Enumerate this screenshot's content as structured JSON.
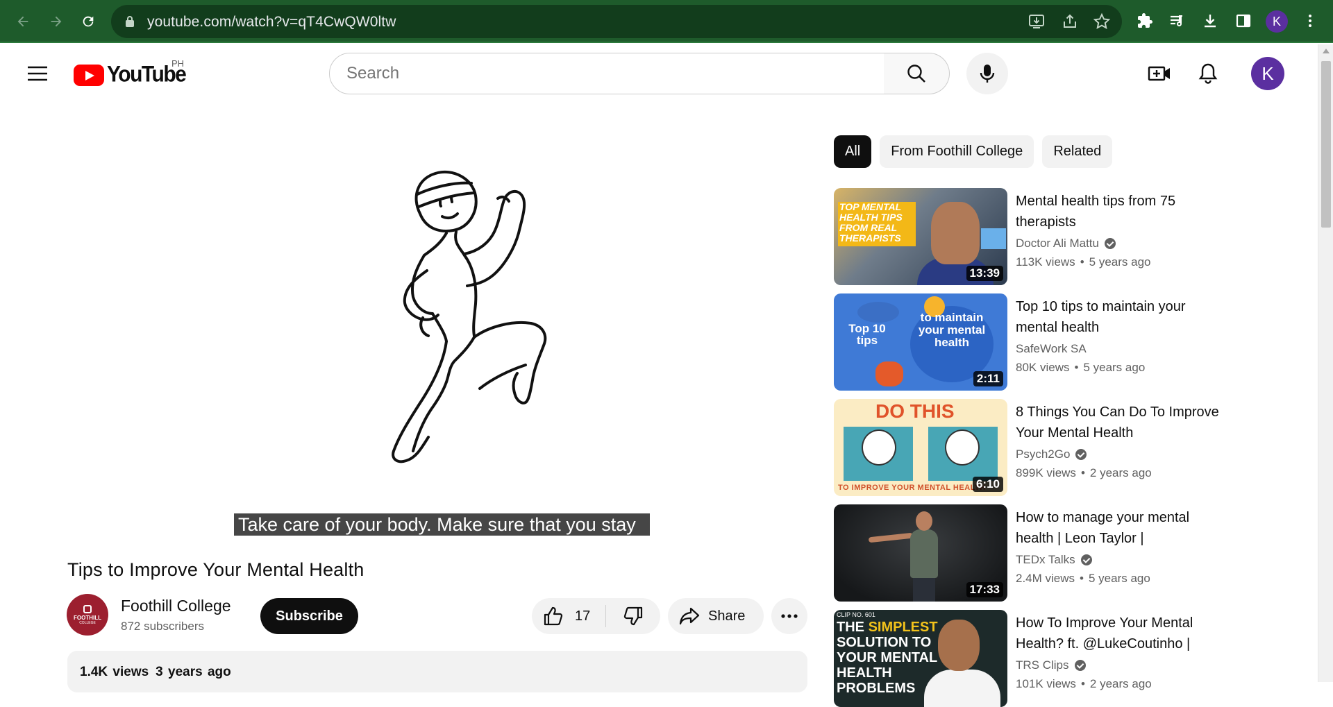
{
  "browser": {
    "url": "youtube.com/watch?v=qT4CwQW0ltw",
    "profile_initial": "K"
  },
  "masthead": {
    "logo_text": "YouTube",
    "region": "PH",
    "search_placeholder": "Search",
    "avatar_initial": "K"
  },
  "player": {
    "caption": "Take care of your body. Make sure that you stay"
  },
  "video": {
    "title": "Tips to Improve Your Mental Health",
    "channel": "Foothill College",
    "channel_avatar_text": "FOOTHILL",
    "channel_avatar_subtext": "COLLEGE",
    "subscribers": "872 subscribers",
    "subscribe_label": "Subscribe",
    "likes": "17",
    "share_label": "Share",
    "views": "1.4K views",
    "age": "3 years ago"
  },
  "chips": [
    {
      "label": "All",
      "active": true
    },
    {
      "label": "From Foothill College",
      "active": false
    },
    {
      "label": "Related",
      "active": false
    }
  ],
  "recommendations": [
    {
      "title": "Mental health tips from 75 therapists",
      "channel": "Doctor Ali Mattu",
      "verified": true,
      "views": "113K views",
      "age": "5 years ago",
      "duration": "13:39",
      "thumb_text": "TOP MENTAL HEALTH TIPS FROM REAL THERAPISTS"
    },
    {
      "title": "Top 10 tips to maintain your mental health",
      "channel": "SafeWork SA",
      "verified": false,
      "views": "80K views",
      "age": "5 years ago",
      "duration": "2:11",
      "thumb_text_left": "Top 10 tips",
      "thumb_text_right": "to maintain your mental health"
    },
    {
      "title": "8 Things You Can Do To Improve Your Mental Health",
      "channel": "Psych2Go",
      "verified": true,
      "views": "899K views",
      "age": "2 years ago",
      "duration": "6:10",
      "thumb_text_top": "DO THIS",
      "thumb_text_bottom": "TO IMPROVE YOUR MENTAL HEALTH"
    },
    {
      "title": "How to manage your mental health | Leon Taylor | TEDxClapham",
      "channel": "TEDx Talks",
      "verified": true,
      "views": "2.4M views",
      "age": "5 years ago",
      "duration": "17:33"
    },
    {
      "title": "How To Improve Your Mental Health? ft. @LukeCoutinho | Ranveer Allahbadia",
      "channel": "TRS Clips",
      "verified": true,
      "views": "101K views",
      "age": "2 years ago",
      "thumb_label": "CLIP NO. 601",
      "thumb_text_a": "THE ",
      "thumb_text_b": "SIMPLEST",
      "thumb_text_c": "SOLUTION TO YOUR MENTAL HEALTH PROBLEMS"
    }
  ]
}
